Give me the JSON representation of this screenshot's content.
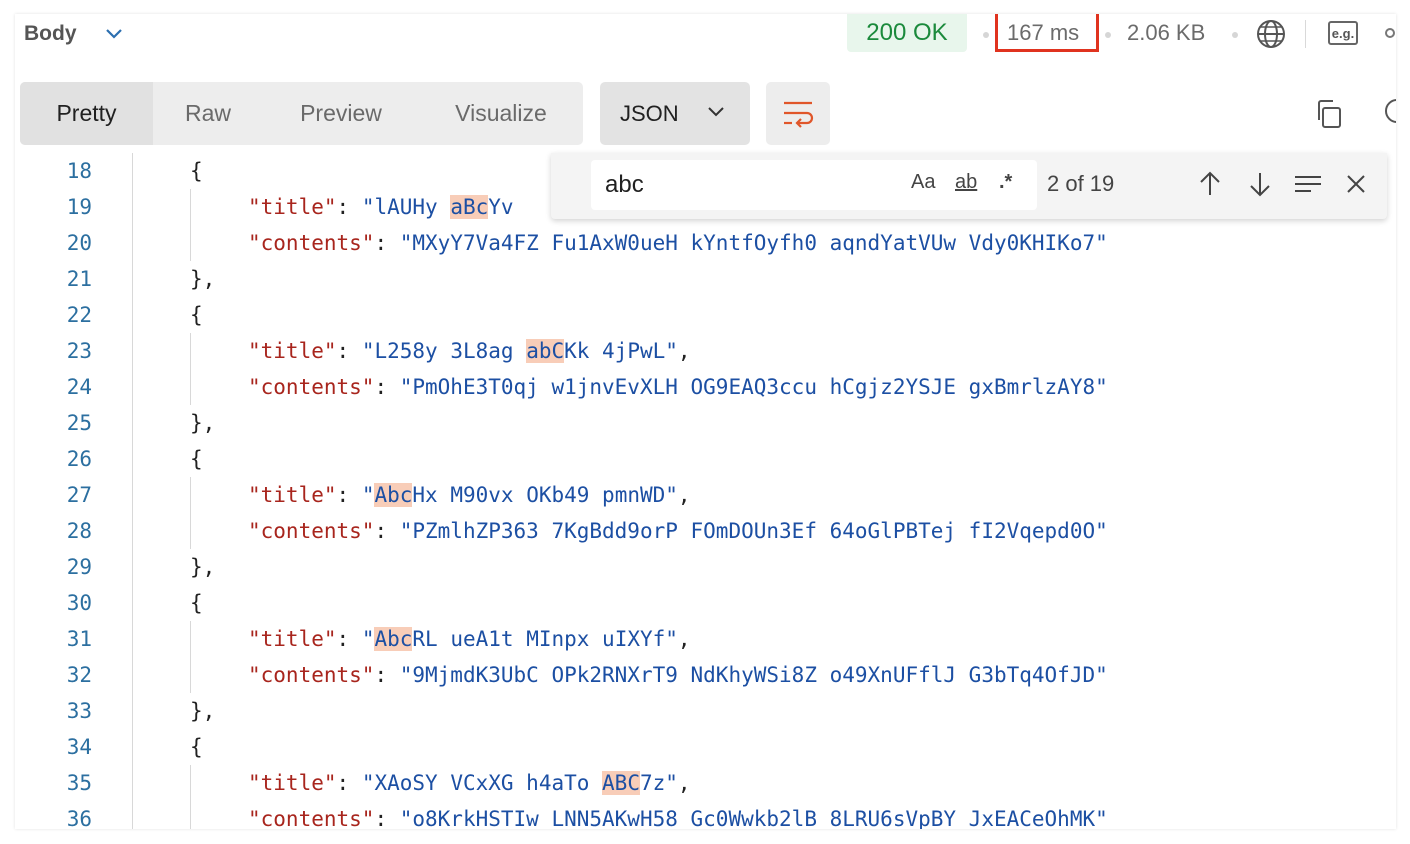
{
  "header": {
    "body_label": "Body",
    "status": "200 OK",
    "time": "167 ms",
    "size": "2.06 KB",
    "eg_label": "e.g."
  },
  "toolbar": {
    "tabs": [
      "Pretty",
      "Raw",
      "Preview",
      "Visualize"
    ],
    "active_tab": "Pretty",
    "format": "JSON"
  },
  "find": {
    "query": "abc",
    "case_label": "Aa",
    "word_label": "ab",
    "regex_label": ".*",
    "count": "2 of 19"
  },
  "colors": {
    "status_green": "#1b8a3c",
    "highlight_box": "#e0331f",
    "json_key": "#a8251d",
    "json_string": "#1c4fa3",
    "match_highlight": "#f8cdb8"
  },
  "code": {
    "line_numbers": [
      "18",
      "19",
      "20",
      "21",
      "22",
      "23",
      "24",
      "25",
      "26",
      "27",
      "28",
      "29",
      "30",
      "31",
      "32",
      "33",
      "34",
      "35",
      "36"
    ],
    "title_key": "\"title\"",
    "contents_key": "\"contents\"",
    "open_brace": "{",
    "close_brace": "},",
    "objects": [
      {
        "title_pre": "\"lAUHy ",
        "title_match": "aBc",
        "title_post": "Yv",
        "contents": "\"MXyY7Va4FZ Fu1AxW0ueH kYntfOyfh0 aqndYatVUw Vdy0KHIKo7\""
      },
      {
        "title_pre": "\"L258y 3L8ag ",
        "title_match": "abC",
        "title_post": "Kk 4jPwL\"",
        "contents": "\"PmOhE3T0qj w1jnvEvXLH OG9EAQ3ccu hCgjz2YSJE gxBmrlzAY8\""
      },
      {
        "title_pre": "\"",
        "title_match": "Abc",
        "title_post": "Hx M90vx OKb49 pmnWD\"",
        "contents": "\"PZmlhZP363 7KgBdd9orP FOmDOUn3Ef 64oGlPBTej fI2Vqepd0O\""
      },
      {
        "title_pre": "\"",
        "title_match": "Abc",
        "title_post": "RL ueA1t MInpx uIXYf\"",
        "contents": "\"9MjmdK3UbC OPk2RNXrT9 NdKhyWSi8Z o49XnUFflJ G3bTq4OfJD\""
      },
      {
        "title_pre": "\"XAoSY VCxXG h4aTo ",
        "title_match": "ABC",
        "title_post": "7z\"",
        "contents": "\"o8KrkHSTIw LNN5AKwH58 Gc0Wwkb2lB 8LRU6sVpBY JxEACeOhMK\""
      }
    ]
  }
}
